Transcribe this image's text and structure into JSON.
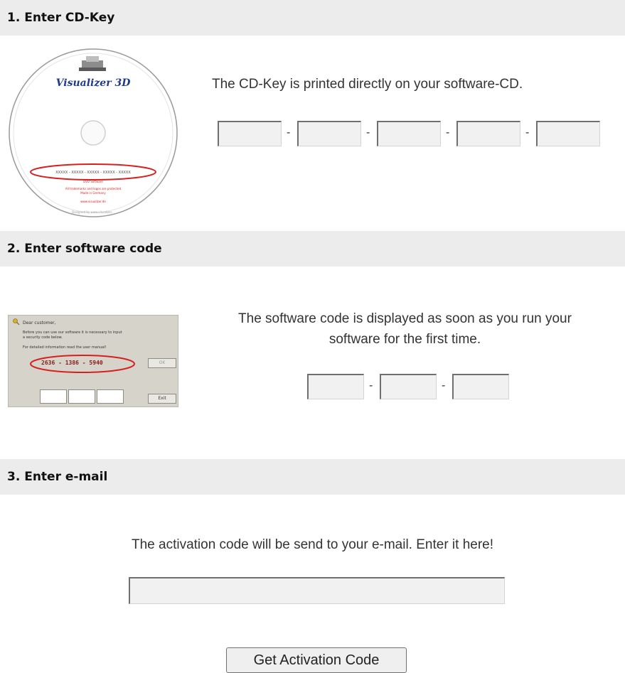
{
  "sections": [
    {
      "title": "1. Enter CD-Key",
      "description": "The CD-Key is printed directly on your software-CD."
    },
    {
      "title": "2. Enter software code",
      "description_lines": [
        "The software code is displayed as soon as you run your",
        "software for the first time."
      ]
    },
    {
      "title": "3. Enter e-mail",
      "description": "The activation code will be send to your e-mail. Enter it here!"
    }
  ],
  "cd_key": {
    "fields": [
      "",
      "",
      "",
      "",
      ""
    ],
    "separator": "-"
  },
  "software_code": {
    "fields": [
      "",
      "",
      ""
    ],
    "separator": "-"
  },
  "activation_code": {
    "value": ""
  },
  "cd_image": {
    "brand": "Visualizer 3D",
    "key_line": "XXXXX - XXXXX - XXXXX - XXXXX - XXXXX",
    "line1": "DVD Software",
    "line2": "All trademarks and logos are protected",
    "line3": "Made in Germany",
    "line4": "www.visualizer.de",
    "rim_text": "Designed by www.visualizer..."
  },
  "dialog_image": {
    "greeting": "Dear customer,",
    "line1": "Before you can use our software it is necessary to input",
    "line2": "a security code below.",
    "line3": "For detailed information read the user manual!",
    "code": "2636 - 1386 - 5940",
    "ok_label": "OK",
    "exit_label": "Exit"
  },
  "button": {
    "label": "Get Activation Code"
  },
  "colors": {
    "header_bg": "#ececec",
    "ellipse": "#d62020",
    "brand": "#1f3a8a"
  }
}
